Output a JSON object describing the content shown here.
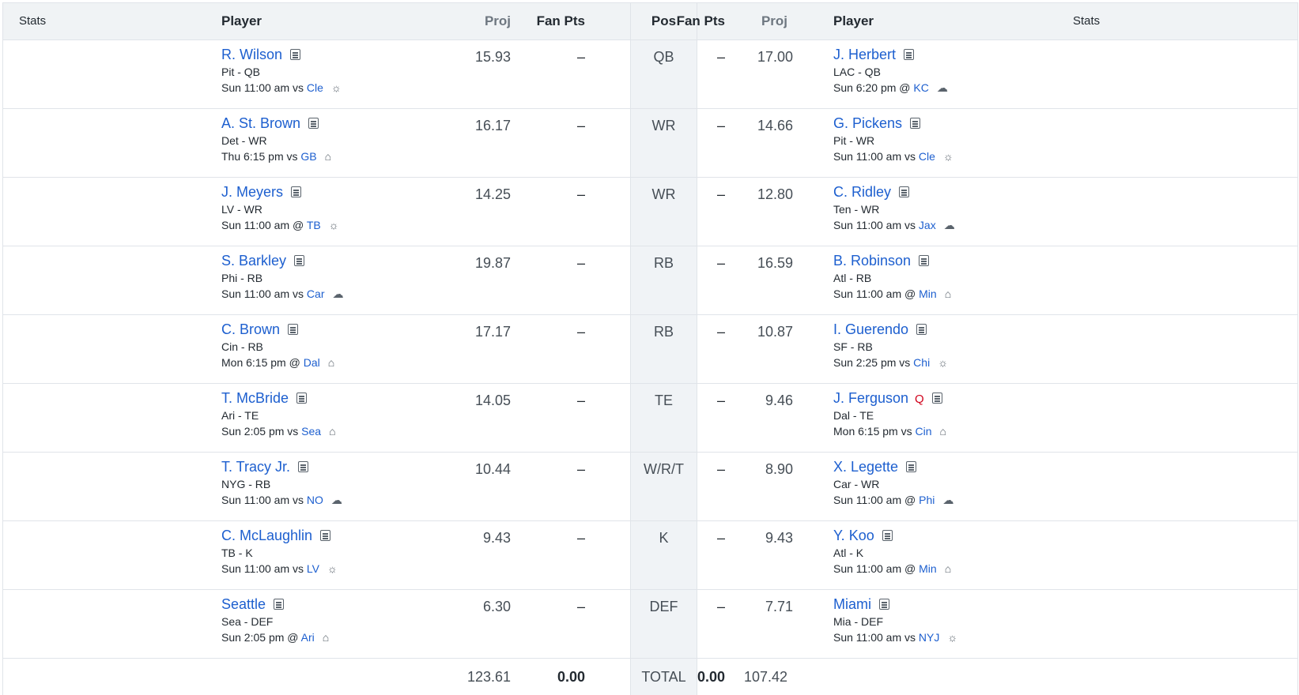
{
  "header": {
    "left_stats": "Stats",
    "left_player": "Player",
    "left_proj": "Proj",
    "left_fanpts": "Fan Pts",
    "pos": "Pos",
    "right_fanpts": "Fan Pts",
    "right_proj": "Proj",
    "right_player": "Player",
    "right_stats": "Stats"
  },
  "rows": [
    {
      "pos": "QB",
      "left": {
        "name": "R. Wilson",
        "team_pos": "Pit - QB",
        "game_prefix": "Sun 11:00 am vs ",
        "opp": "Cle",
        "weather": "sun-icon",
        "weather_glyph": "☼",
        "proj": "15.93",
        "fanpts": "–",
        "injury": ""
      },
      "right": {
        "name": "J. Herbert",
        "team_pos": "LAC - QB",
        "game_prefix": "Sun 6:20 pm @ ",
        "opp": "KC",
        "weather": "cloud-icon",
        "weather_glyph": "☁",
        "proj": "17.00",
        "fanpts": "–",
        "injury": ""
      }
    },
    {
      "pos": "WR",
      "left": {
        "name": "A. St. Brown",
        "team_pos": "Det - WR",
        "game_prefix": "Thu 6:15 pm vs ",
        "opp": "GB",
        "weather": "dome-icon",
        "weather_glyph": "⌂",
        "proj": "16.17",
        "fanpts": "–",
        "injury": ""
      },
      "right": {
        "name": "G. Pickens",
        "team_pos": "Pit - WR",
        "game_prefix": "Sun 11:00 am vs ",
        "opp": "Cle",
        "weather": "sun-icon",
        "weather_glyph": "☼",
        "proj": "14.66",
        "fanpts": "–",
        "injury": ""
      }
    },
    {
      "pos": "WR",
      "left": {
        "name": "J. Meyers",
        "team_pos": "LV - WR",
        "game_prefix": "Sun 11:00 am @ ",
        "opp": "TB",
        "weather": "sun-icon",
        "weather_glyph": "☼",
        "proj": "14.25",
        "fanpts": "–",
        "injury": ""
      },
      "right": {
        "name": "C. Ridley",
        "team_pos": "Ten - WR",
        "game_prefix": "Sun 11:00 am vs ",
        "opp": "Jax",
        "weather": "cloud-icon",
        "weather_glyph": "☁",
        "proj": "12.80",
        "fanpts": "–",
        "injury": ""
      }
    },
    {
      "pos": "RB",
      "left": {
        "name": "S. Barkley",
        "team_pos": "Phi - RB",
        "game_prefix": "Sun 11:00 am vs ",
        "opp": "Car",
        "weather": "cloud-icon",
        "weather_glyph": "☁",
        "proj": "19.87",
        "fanpts": "–",
        "injury": ""
      },
      "right": {
        "name": "B. Robinson",
        "team_pos": "Atl - RB",
        "game_prefix": "Sun 11:00 am @ ",
        "opp": "Min",
        "weather": "dome-icon",
        "weather_glyph": "⌂",
        "proj": "16.59",
        "fanpts": "–",
        "injury": ""
      }
    },
    {
      "pos": "RB",
      "left": {
        "name": "C. Brown",
        "team_pos": "Cin - RB",
        "game_prefix": "Mon 6:15 pm @ ",
        "opp": "Dal",
        "weather": "dome-icon",
        "weather_glyph": "⌂",
        "proj": "17.17",
        "fanpts": "–",
        "injury": ""
      },
      "right": {
        "name": "I. Guerendo",
        "team_pos": "SF - RB",
        "game_prefix": "Sun 2:25 pm vs ",
        "opp": "Chi",
        "weather": "sun-icon",
        "weather_glyph": "☼",
        "proj": "10.87",
        "fanpts": "–",
        "injury": ""
      }
    },
    {
      "pos": "TE",
      "left": {
        "name": "T. McBride",
        "team_pos": "Ari - TE",
        "game_prefix": "Sun 2:05 pm vs ",
        "opp": "Sea",
        "weather": "dome-icon",
        "weather_glyph": "⌂",
        "proj": "14.05",
        "fanpts": "–",
        "injury": ""
      },
      "right": {
        "name": "J. Ferguson",
        "team_pos": "Dal - TE",
        "game_prefix": "Mon 6:15 pm vs ",
        "opp": "Cin",
        "weather": "dome-icon",
        "weather_glyph": "⌂",
        "proj": "9.46",
        "fanpts": "–",
        "injury": "Q"
      }
    },
    {
      "pos": "W/R/T",
      "left": {
        "name": "T. Tracy Jr.",
        "team_pos": "NYG - RB",
        "game_prefix": "Sun 11:00 am vs ",
        "opp": "NO",
        "weather": "cloud-icon",
        "weather_glyph": "☁",
        "proj": "10.44",
        "fanpts": "–",
        "injury": ""
      },
      "right": {
        "name": "X. Legette",
        "team_pos": "Car - WR",
        "game_prefix": "Sun 11:00 am @ ",
        "opp": "Phi",
        "weather": "cloud-icon",
        "weather_glyph": "☁",
        "proj": "8.90",
        "fanpts": "–",
        "injury": ""
      }
    },
    {
      "pos": "K",
      "left": {
        "name": "C. McLaughlin",
        "team_pos": "TB - K",
        "game_prefix": "Sun 11:00 am vs ",
        "opp": "LV",
        "weather": "sun-icon",
        "weather_glyph": "☼",
        "proj": "9.43",
        "fanpts": "–",
        "injury": ""
      },
      "right": {
        "name": "Y. Koo",
        "team_pos": "Atl - K",
        "game_prefix": "Sun 11:00 am @ ",
        "opp": "Min",
        "weather": "dome-icon",
        "weather_glyph": "⌂",
        "proj": "9.43",
        "fanpts": "–",
        "injury": ""
      }
    },
    {
      "pos": "DEF",
      "left": {
        "name": "Seattle",
        "team_pos": "Sea - DEF",
        "game_prefix": "Sun 2:05 pm @ ",
        "opp": "Ari",
        "weather": "dome-icon",
        "weather_glyph": "⌂",
        "proj": "6.30",
        "fanpts": "–",
        "injury": ""
      },
      "right": {
        "name": "Miami",
        "team_pos": "Mia - DEF",
        "game_prefix": "Sun 11:00 am vs ",
        "opp": "NYJ",
        "weather": "sun-icon",
        "weather_glyph": "☼",
        "proj": "7.71",
        "fanpts": "–",
        "injury": ""
      }
    }
  ],
  "totals": {
    "left_proj": "123.61",
    "left_fanpts": "0.00",
    "label": "TOTAL",
    "right_fanpts": "0.00",
    "right_proj": "107.42"
  }
}
